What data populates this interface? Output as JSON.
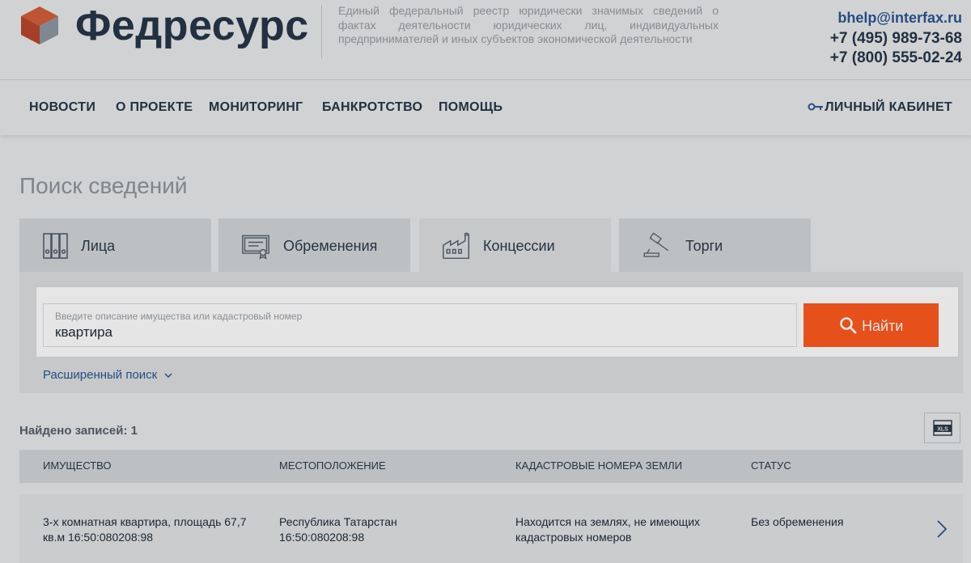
{
  "header": {
    "brand": "Федресурс",
    "tagline": "Единый федеральный реестр юридически значимых сведений о фактах деятельности юридических лиц, индивидуальных предпринимателей и иных субъектов экономической деятельности",
    "email": "bhelp@interfax.ru",
    "phone1": "+7 (495) 989-73-68",
    "phone2": "+7 (800) 555-02-24"
  },
  "nav": {
    "items": [
      "НОВОСТИ",
      "О ПРОЕКТЕ",
      "МОНИТОРИНГ",
      "БАНКРОТСТВО",
      "ПОМОЩЬ"
    ],
    "cabinet": "ЛИЧНЫЙ КАБИНЕТ"
  },
  "page": {
    "title": "Поиск сведений"
  },
  "tabs": [
    {
      "label": "Лица",
      "icon": "binders-icon"
    },
    {
      "label": "Обременения",
      "icon": "certificate-icon"
    },
    {
      "label": "Концессии",
      "icon": "factory-icon",
      "active": true
    },
    {
      "label": "Торги",
      "icon": "gavel-icon"
    }
  ],
  "search": {
    "placeholder": "Введите описание имущества или кадастровый номер",
    "value": "квартира",
    "button": "Найти",
    "advanced": "Расширенный поиск"
  },
  "results": {
    "count_label": "Найдено записей: 1",
    "columns": [
      "Имущество",
      "Местоположение",
      "Кадастровые номера земли",
      "Статус"
    ],
    "rows": [
      {
        "property_line1": "3-х комнатная квартира, площадь 67,7",
        "property_line2": "кв.м 16:50:080208:98",
        "location_line1": "Республика Татарстан",
        "location_line2": "16:50:080208:98",
        "cadastral_line1": "Находится на землях, не имеющих",
        "cadastral_line2": "кадастровых номеров",
        "status": "Без обременения"
      }
    ]
  },
  "colors": {
    "accent": "#ff5a1f",
    "brand_dark": "#26364a",
    "link": "#2d5a9b"
  }
}
